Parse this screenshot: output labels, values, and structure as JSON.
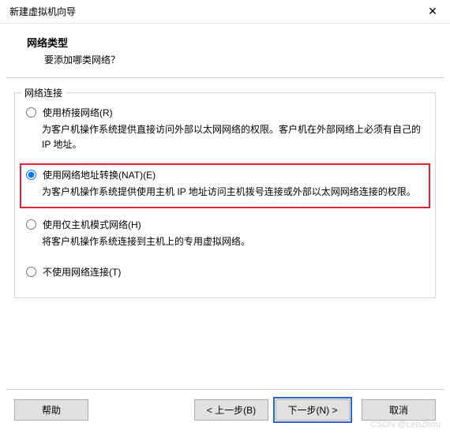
{
  "window": {
    "title": "新建虚拟机向导",
    "close": "✕"
  },
  "header": {
    "title": "网络类型",
    "subtitle": "要添加哪类网络？"
  },
  "group": {
    "title": "网络连接"
  },
  "options": {
    "bridged": {
      "label": "使用桥接网络(R)",
      "desc": "为客户机操作系统提供直接访问外部以太网网络的权限。客户机在外部网络上必须有自己的 IP 地址。",
      "checked": false
    },
    "nat": {
      "label": "使用网络地址转换(NAT)(E)",
      "desc": "为客户机操作系统提供使用主机 IP 地址访问主机拨号连接或外部以太网网络连接的权限。",
      "checked": true
    },
    "hostonly": {
      "label": "使用仅主机模式网络(H)",
      "desc": "将客户机操作系统连接到主机上的专用虚拟网络。",
      "checked": false
    },
    "none": {
      "label": "不使用网络连接(T)",
      "checked": false
    }
  },
  "buttons": {
    "help": "帮助",
    "back": "< 上一步(B)",
    "next": "下一步(N) >",
    "cancel": "取消"
  },
  "watermark": "CSDN @LeoZhou"
}
